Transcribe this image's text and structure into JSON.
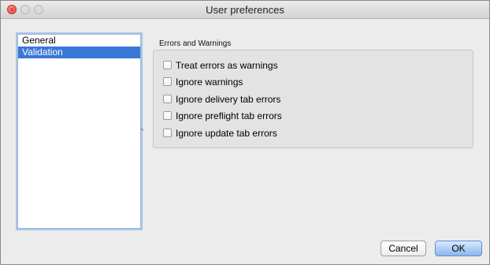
{
  "window": {
    "title": "User preferences",
    "controls": [
      "close-icon",
      "minimize-icon",
      "zoom-icon"
    ],
    "close_glyph": "×"
  },
  "sidebar": {
    "items": [
      {
        "label": "General",
        "selected": false
      },
      {
        "label": "Validation",
        "selected": true
      }
    ],
    "selection_color": "#3a78d8"
  },
  "errors_group": {
    "title": "Errors and Warnings",
    "options": [
      {
        "label": "Treat errors as warnings",
        "checked": false
      },
      {
        "label": "Ignore warnings",
        "checked": false
      },
      {
        "label": "Ignore delivery tab errors",
        "checked": false
      },
      {
        "label": "Ignore preflight tab errors",
        "checked": false
      },
      {
        "label": "Ignore update tab errors",
        "checked": false
      }
    ]
  },
  "buttons": {
    "cancel": "Cancel",
    "ok": "OK"
  }
}
